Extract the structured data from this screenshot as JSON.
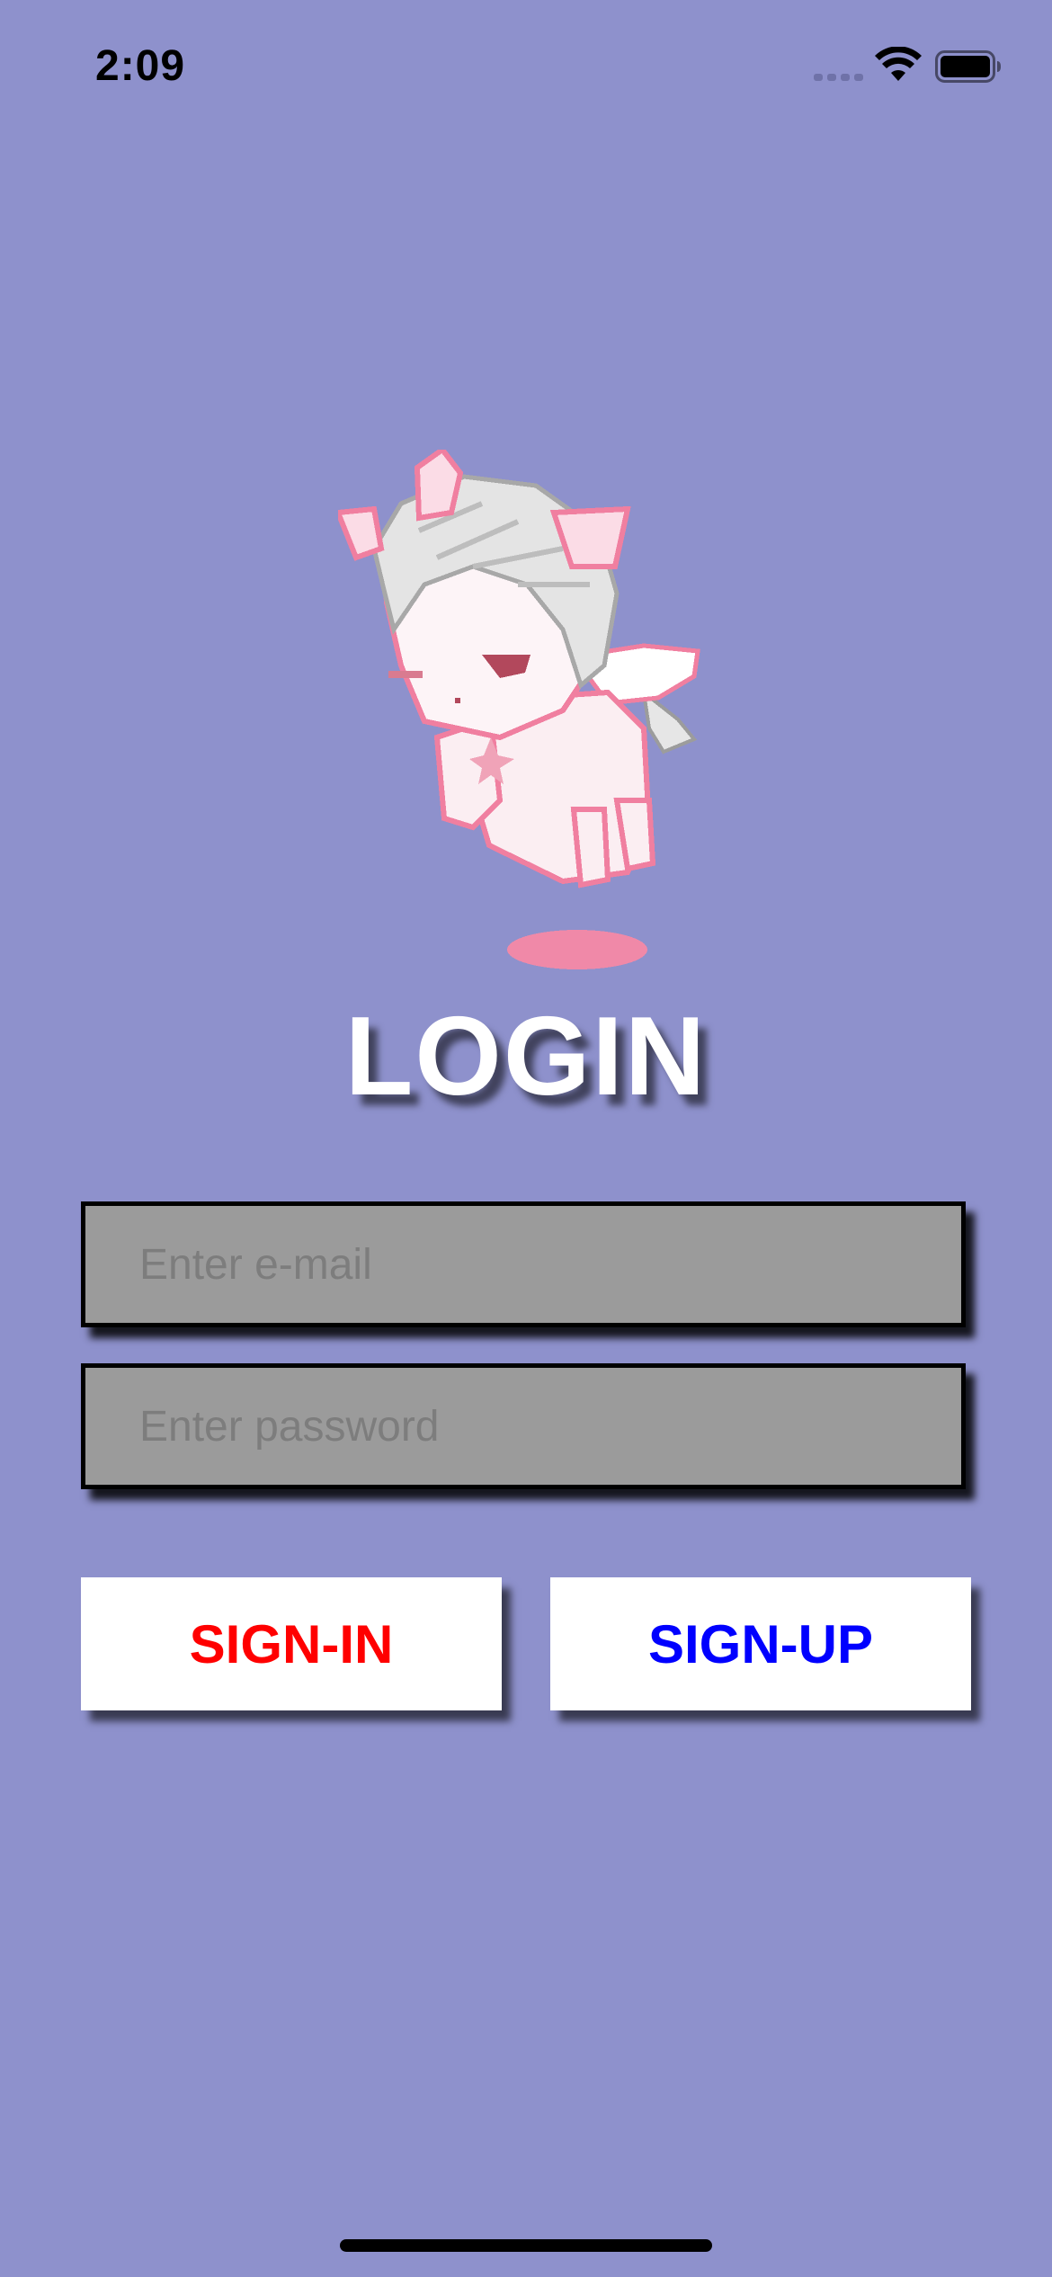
{
  "status_bar": {
    "time": "2:09",
    "icons": [
      "signal-icon",
      "wifi-icon",
      "battery-icon"
    ]
  },
  "screen": {
    "title": "LOGIN",
    "background_color": "#8e91cc",
    "mascot": "pixel-art-pegasus-unicorn"
  },
  "form": {
    "email_placeholder": "Enter e-mail",
    "email_value": "",
    "password_placeholder": "Enter password",
    "password_value": ""
  },
  "buttons": {
    "signin_label": "SIGN-IN",
    "signin_color": "#ff0000",
    "signup_label": "SIGN-UP",
    "signup_color": "#0000ff"
  }
}
